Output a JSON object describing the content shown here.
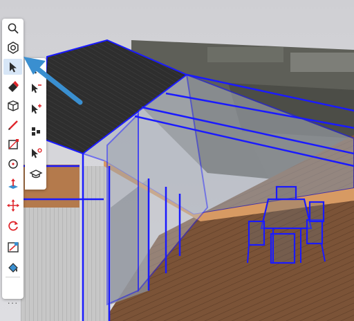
{
  "toolbar": {
    "tools": [
      {
        "name": "search-icon"
      },
      {
        "name": "gear-icon"
      },
      {
        "name": "select-tool-icon",
        "active": true
      },
      {
        "name": "eraser-icon"
      },
      {
        "name": "cube-icon"
      },
      {
        "name": "pencil-icon"
      },
      {
        "name": "rectangle-icon"
      },
      {
        "name": "circle-icon"
      },
      {
        "name": "push-pull-icon"
      },
      {
        "name": "move-icon"
      },
      {
        "name": "rotate-icon"
      },
      {
        "name": "tape-measure-icon"
      },
      {
        "name": "paint-bucket-icon"
      }
    ],
    "more_label": "···"
  },
  "subtoolbar": {
    "tools": [
      {
        "name": "select-add-icon"
      },
      {
        "name": "select-remove-icon"
      },
      {
        "name": "select-toggle-icon"
      },
      {
        "name": "select-components-icon"
      },
      {
        "name": "select-edit-icon"
      },
      {
        "name": "select-graduation-icon"
      }
    ]
  },
  "colors": {
    "accent": "#3a8fd0",
    "selection": "#1a1aff",
    "tool_icon": "#2b2b2b",
    "tool_accent": "#e0262b",
    "deck": "#7a5236",
    "roof": "#2f2f2f"
  }
}
